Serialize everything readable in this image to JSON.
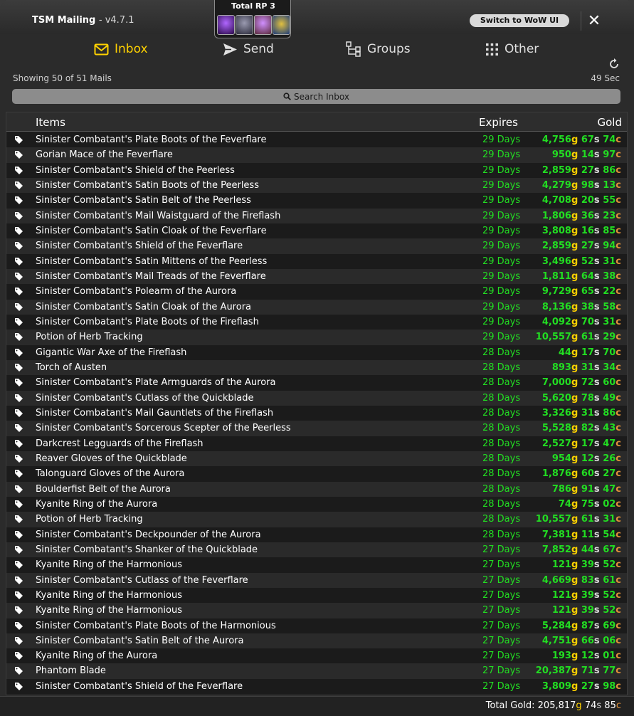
{
  "window": {
    "title": "TSM Mailing",
    "version": "- v4.7.1"
  },
  "rp": {
    "label": "Total RP 3"
  },
  "header": {
    "switch_label": "Switch to WoW UI"
  },
  "tabs": [
    {
      "label": "Inbox",
      "icon": "envelope-icon",
      "active": true
    },
    {
      "label": "Send",
      "icon": "paper-plane-icon",
      "active": false
    },
    {
      "label": "Groups",
      "icon": "groups-tree-icon",
      "active": false
    },
    {
      "label": "Other",
      "icon": "grid-dots-icon",
      "active": false
    }
  ],
  "status": {
    "showing": "Showing 50 of 51 Mails",
    "timer": "49 Sec"
  },
  "search": {
    "placeholder": "Search Inbox"
  },
  "columns": {
    "items": "Items",
    "expires": "Expires",
    "gold": "Gold"
  },
  "rows": [
    {
      "name": "Sinister Combatant's Plate Boots of the Feverflare",
      "expires": "29 Days",
      "g": "4,756",
      "s": "67",
      "c": "74"
    },
    {
      "name": "Gorian Mace of the Feverflare",
      "expires": "29 Days",
      "g": "950",
      "s": "14",
      "c": "97"
    },
    {
      "name": "Sinister Combatant's Shield of the Peerless",
      "expires": "29 Days",
      "g": "2,859",
      "s": "27",
      "c": "86"
    },
    {
      "name": "Sinister Combatant's Satin Boots of the Peerless",
      "expires": "29 Days",
      "g": "4,279",
      "s": "98",
      "c": "13"
    },
    {
      "name": "Sinister Combatant's Satin Belt of the Peerless",
      "expires": "29 Days",
      "g": "4,708",
      "s": "20",
      "c": "55"
    },
    {
      "name": "Sinister Combatant's Mail Waistguard of the Fireflash",
      "expires": "29 Days",
      "g": "1,806",
      "s": "36",
      "c": "23"
    },
    {
      "name": "Sinister Combatant's Satin Cloak of the Feverflare",
      "expires": "29 Days",
      "g": "3,808",
      "s": "16",
      "c": "85"
    },
    {
      "name": "Sinister Combatant's Shield of the Feverflare",
      "expires": "29 Days",
      "g": "2,859",
      "s": "27",
      "c": "94"
    },
    {
      "name": "Sinister Combatant's Satin Mittens of the Peerless",
      "expires": "29 Days",
      "g": "3,496",
      "s": "52",
      "c": "31"
    },
    {
      "name": "Sinister Combatant's Mail Treads of the Feverflare",
      "expires": "29 Days",
      "g": "1,811",
      "s": "64",
      "c": "38"
    },
    {
      "name": "Sinister Combatant's Polearm of the Aurora",
      "expires": "29 Days",
      "g": "9,729",
      "s": "65",
      "c": "22"
    },
    {
      "name": "Sinister Combatant's Satin Cloak of the Aurora",
      "expires": "29 Days",
      "g": "8,136",
      "s": "38",
      "c": "58"
    },
    {
      "name": "Sinister Combatant's Plate Boots of the Fireflash",
      "expires": "29 Days",
      "g": "4,092",
      "s": "70",
      "c": "31"
    },
    {
      "name": "Potion of Herb Tracking",
      "expires": "29 Days",
      "g": "10,557",
      "s": "61",
      "c": "29"
    },
    {
      "name": "Gigantic War Axe of the Fireflash",
      "expires": "28 Days",
      "g": "44",
      "s": "17",
      "c": "70"
    },
    {
      "name": "Torch of Austen",
      "expires": "28 Days",
      "g": "893",
      "s": "31",
      "c": "34"
    },
    {
      "name": "Sinister Combatant's Plate Armguards of the Aurora",
      "expires": "28 Days",
      "g": "7,000",
      "s": "72",
      "c": "60"
    },
    {
      "name": "Sinister Combatant's Cutlass of the Quickblade",
      "expires": "28 Days",
      "g": "5,620",
      "s": "78",
      "c": "49"
    },
    {
      "name": "Sinister Combatant's Mail Gauntlets of the Fireflash",
      "expires": "28 Days",
      "g": "3,326",
      "s": "31",
      "c": "86"
    },
    {
      "name": "Sinister Combatant's Sorcerous Scepter of the Peerless",
      "expires": "28 Days",
      "g": "5,528",
      "s": "82",
      "c": "43"
    },
    {
      "name": "Darkcrest Legguards of the Fireflash",
      "expires": "28 Days",
      "g": "2,527",
      "s": "17",
      "c": "47"
    },
    {
      "name": "Reaver Gloves of the Quickblade",
      "expires": "28 Days",
      "g": "954",
      "s": "12",
      "c": "26"
    },
    {
      "name": "Talonguard Gloves of the Aurora",
      "expires": "28 Days",
      "g": "1,876",
      "s": "60",
      "c": "27"
    },
    {
      "name": "Boulderfist Belt of the Aurora",
      "expires": "28 Days",
      "g": "786",
      "s": "91",
      "c": "47"
    },
    {
      "name": "Kyanite Ring of the Aurora",
      "expires": "28 Days",
      "g": "74",
      "s": "75",
      "c": "02"
    },
    {
      "name": "Potion of Herb Tracking",
      "expires": "28 Days",
      "g": "10,557",
      "s": "61",
      "c": "31"
    },
    {
      "name": "Sinister Combatant's Deckpounder of the Aurora",
      "expires": "28 Days",
      "g": "7,381",
      "s": "11",
      "c": "54"
    },
    {
      "name": "Sinister Combatant's Shanker of the Quickblade",
      "expires": "27 Days",
      "g": "7,852",
      "s": "44",
      "c": "67"
    },
    {
      "name": "Kyanite Ring of the Harmonious",
      "expires": "27 Days",
      "g": "121",
      "s": "39",
      "c": "52"
    },
    {
      "name": "Sinister Combatant's Cutlass of the Feverflare",
      "expires": "27 Days",
      "g": "4,669",
      "s": "83",
      "c": "61"
    },
    {
      "name": "Kyanite Ring of the Harmonious",
      "expires": "27 Days",
      "g": "121",
      "s": "39",
      "c": "52"
    },
    {
      "name": "Kyanite Ring of the Harmonious",
      "expires": "27 Days",
      "g": "121",
      "s": "39",
      "c": "52"
    },
    {
      "name": "Sinister Combatant's Plate Boots of the Harmonious",
      "expires": "27 Days",
      "g": "5,284",
      "s": "87",
      "c": "69"
    },
    {
      "name": "Sinister Combatant's Satin Belt of the Aurora",
      "expires": "27 Days",
      "g": "4,751",
      "s": "66",
      "c": "06"
    },
    {
      "name": "Kyanite Ring of the Aurora",
      "expires": "27 Days",
      "g": "193",
      "s": "12",
      "c": "01"
    },
    {
      "name": "Phantom Blade",
      "expires": "27 Days",
      "g": "20,387",
      "s": "71",
      "c": "77"
    },
    {
      "name": "Sinister Combatant's Shield of the Feverflare",
      "expires": "27 Days",
      "g": "3,809",
      "s": "27",
      "c": "98"
    }
  ],
  "units": {
    "gold": "g",
    "silver": "s",
    "copper": "c"
  },
  "footer": {
    "total_label": "Total Gold: ",
    "g": "205,817",
    "s": "74",
    "c": "85"
  },
  "colors": {
    "gold": "#ffd200",
    "silver": "#d8d8d8",
    "copper": "#e0923a",
    "green": "#22dd22"
  }
}
